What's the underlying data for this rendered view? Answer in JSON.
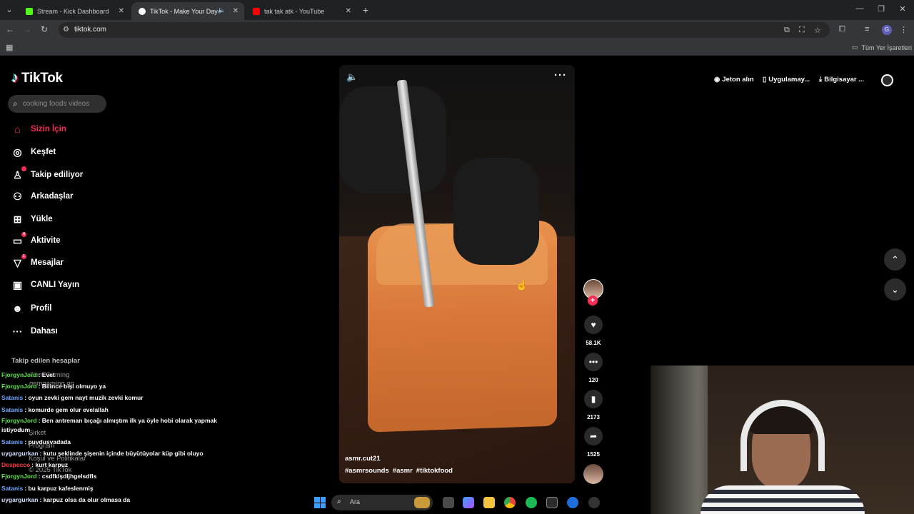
{
  "browser": {
    "tabs": [
      {
        "title": "Stream - Kick Dashboard",
        "color": "#53fc18",
        "active": false
      },
      {
        "title": "TikTok - Make Your Day",
        "color": "#ffffff",
        "active": true
      },
      {
        "title": "tak tak atk - YouTube",
        "color": "#ff0000",
        "active": false
      }
    ],
    "url": "tiktok.com",
    "bookmarks_folder": "Tüm Yer İşaretleri"
  },
  "tiktok": {
    "logo_text": "TikTok",
    "search_placeholder": "cooking foods videos",
    "nav": [
      {
        "label": "Sizin İçin",
        "icon": "home-icon",
        "active": true
      },
      {
        "label": "Keşfet",
        "icon": "compass-icon"
      },
      {
        "label": "Takip ediliyor",
        "icon": "following-icon",
        "dot": ""
      },
      {
        "label": "Arkadaşlar",
        "icon": "friends-icon"
      },
      {
        "label": "Yükle",
        "icon": "upload-icon"
      },
      {
        "label": "Aktivite",
        "icon": "activity-icon",
        "badge": "4"
      },
      {
        "label": "Mesajlar",
        "icon": "messages-icon",
        "badge": "1"
      },
      {
        "label": "CANLI Yayın",
        "icon": "live-icon"
      },
      {
        "label": "Profil",
        "icon": "profile-icon"
      },
      {
        "label": "Dahası",
        "icon": "more-icon"
      }
    ],
    "followed_heading": "Takip edilen hesaplar",
    "followed_ghosts": [
      "Gem Gaming",
      "gemgaming.gg",
      "Şirket",
      "Program",
      "Koşul ve Politikalar",
      "© 2025 TikTok"
    ],
    "top_links": [
      {
        "label": "Jeton alın",
        "icon": "coin-icon"
      },
      {
        "label": "Uygulamay...",
        "icon": "phone-icon"
      },
      {
        "label": "Bilgisayar ...",
        "icon": "download-icon"
      }
    ],
    "video": {
      "author": "asmr.cut21",
      "tags": [
        "#asmrsounds",
        "#asmr",
        "#tiktokfood"
      ]
    },
    "actions": {
      "likes": "58.1K",
      "comments": "120",
      "saves": "2173",
      "shares": "1525"
    }
  },
  "chat": [
    {
      "user": "FjorgynJord",
      "color": "#5be34a",
      "text": ": Evet"
    },
    {
      "user": "FjorgynJord",
      "color": "#5be34a",
      "text": ": Bilince bişi olmuyo ya"
    },
    {
      "user": "Satanis",
      "color": "#6fa8ff",
      "text": ": oyun zevki gem nayt muzik zevki komur"
    },
    {
      "user": "Satanis",
      "color": "#6fa8ff",
      "text": ": komurde gem olur evelallah"
    },
    {
      "user": "FjorgynJord",
      "color": "#5be34a",
      "text": ": Ben antreman bıçağı almıştım ilk ya öyle hobi olarak yapmak istiyodum",
      "wrap": true
    },
    {
      "user": "Satanis",
      "color": "#6fa8ff",
      "text": ": puvdusvadada"
    },
    {
      "user": "uygargurkan",
      "color": "#d7e0ff",
      "text": ": kutu şeklinde şişenin içinde büyütüyolar küp gibi oluyo"
    },
    {
      "user": "Despecco",
      "color": "#ff3b3b",
      "text": ": kurt karpuz"
    },
    {
      "user": "FjorgynJord",
      "color": "#5be34a",
      "text": ": csdfklşdljhgelsdfls"
    },
    {
      "user": "Satanis",
      "color": "#6fa8ff",
      "text": ": bu karpuz kafeslenmiş"
    },
    {
      "user": "uygargurkan",
      "color": "#d7e0ff",
      "text": ": karpuz olsa da olur olmasa da"
    }
  ],
  "taskbar": {
    "search_label": "Ara"
  }
}
